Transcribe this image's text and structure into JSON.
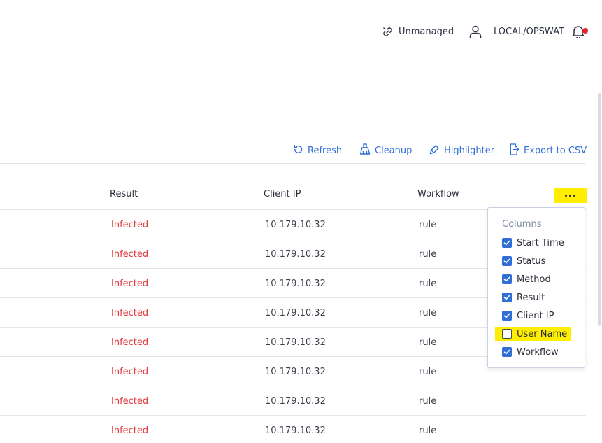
{
  "topbar": {
    "unmanaged_label": "Unmanaged",
    "user_label": "LOCAL/OPSWAT",
    "notification_dot_color": "#e0262c"
  },
  "toolbar": {
    "refresh_label": "Refresh",
    "cleanup_label": "Cleanup",
    "highlighter_label": "Highlighter",
    "export_label": "Export to CSV",
    "accent_color": "#2f6fd6"
  },
  "table": {
    "headers": {
      "result": "Result",
      "client_ip": "Client IP",
      "workflow": "Workflow"
    },
    "rows": [
      {
        "result": "Infected",
        "client_ip": "10.179.10.32",
        "workflow": "rule"
      },
      {
        "result": "Infected",
        "client_ip": "10.179.10.32",
        "workflow": "rule"
      },
      {
        "result": "Infected",
        "client_ip": "10.179.10.32",
        "workflow": "rule"
      },
      {
        "result": "Infected",
        "client_ip": "10.179.10.32",
        "workflow": "rule"
      },
      {
        "result": "Infected",
        "client_ip": "10.179.10.32",
        "workflow": "rule"
      },
      {
        "result": "Infected",
        "client_ip": "10.179.10.32",
        "workflow": "rule"
      },
      {
        "result": "Infected",
        "client_ip": "10.179.10.32",
        "workflow": "rule"
      },
      {
        "result": "Infected",
        "client_ip": "10.179.10.32",
        "workflow": "rule"
      }
    ],
    "infected_color": "#e1373c"
  },
  "columns_menu": {
    "title": "Columns",
    "options": [
      {
        "label": "Start Time",
        "checked": true
      },
      {
        "label": "Status",
        "checked": true
      },
      {
        "label": "Method",
        "checked": true
      },
      {
        "label": "Result",
        "checked": true
      },
      {
        "label": "Client IP",
        "checked": true
      },
      {
        "label": "User Name",
        "checked": false
      },
      {
        "label": "Workflow",
        "checked": true
      }
    ],
    "highlight_color": "#ffee00"
  }
}
